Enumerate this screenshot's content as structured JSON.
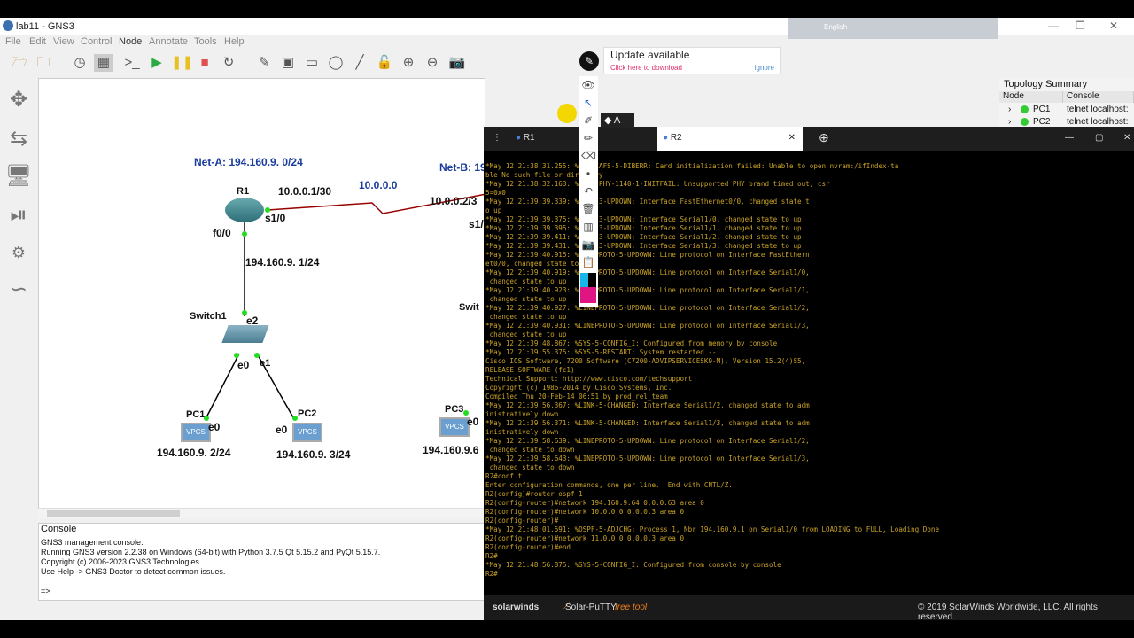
{
  "window": {
    "title": "lab11 - GNS3"
  },
  "menu": [
    "File",
    "Edit",
    "View",
    "Control",
    "Node",
    "Annotate",
    "Tools",
    "Help"
  ],
  "lang": "English",
  "update": {
    "title": "Update available",
    "link": "Click here to download",
    "ignore": "ignore"
  },
  "topology": {
    "title": "Topology Summary",
    "col_node": "Node",
    "col_console": "Console",
    "rows": [
      {
        "node": "PC1",
        "console": "telnet localhost:"
      },
      {
        "node": "PC2",
        "console": "telnet localhost:"
      }
    ]
  },
  "diagram": {
    "net_a": "Net-A: 194.160.9. 0/24",
    "net_b": "Net-B: 19",
    "link_net": "10.0.0.0",
    "r1": "R1",
    "r1_s1": "10.0.0.1/30",
    "r1_s1_if": "s1/0",
    "r1_f0": "f0/0",
    "r1_f0_ip": "194.160.9. 1/24",
    "r2_s1": "10.0.0.2/3",
    "r2_s1_if": "s1/",
    "switch1": "Switch1",
    "sw_e2": "e2",
    "sw_e0": "e0",
    "sw_e1": "e1",
    "switch2": "Swit",
    "pc1": "PC1",
    "pc1_e0": "e0",
    "pc1_ip": "194.160.9. 2/24",
    "pc2": "PC2",
    "pc2_e0": "e0",
    "pc2_ip": "194.160.9. 3/24",
    "pc3": "PC3",
    "pc3_e0": "e0",
    "pc3_ip": "194.160.9.6",
    "vpcs": "VPCS"
  },
  "console": {
    "title": "Console",
    "lines": [
      "GNS3 management console.",
      "Running GNS3 version 2.2.38 on Windows (64-bit) with Python 3.7.5 Qt 5.15.2 and PyQt 5.15.7.",
      "Copyright (c) 2006-2023 GNS3 Technologies.",
      "Use Help -> GNS3 Doctor to detect common issues.",
      "",
      "=>"
    ]
  },
  "putty": {
    "tabs": [
      "R1",
      "R2"
    ],
    "footer_brand": "solarwinds",
    "footer_app": "Solar-PuTTY",
    "footer_free": "free tool",
    "copyright": "© 2019 SolarWinds Worldwide, LLC. All rights reserved.",
    "terminal": "*May 12 21:38:31.255: %PCMCIAFS-5-DIBERR: Card initialization failed: Unable to open nvram:/ifIndex-ta\nble No such file or directory\n*May 12 21:38:32.163: %PA-3-PHY-1140-1-INITFAIL: Unsupported PHY brand timed out, csr\n5=0x0\n*May 12 21:39:39.339: %LINK-3-UPDOWN: Interface FastEthernet0/0, changed state t\no up\n*May 12 21:39:39.375: %LINK-3-UPDOWN: Interface Serial1/0, changed state to up\n*May 12 21:39:39.395: %LINK-3-UPDOWN: Interface Serial1/1, changed state to up\n*May 12 21:39:39.411: %LINK-3-UPDOWN: Interface Serial1/2, changed state to up\n*May 12 21:39:39.431: %LINK-3-UPDOWN: Interface Serial1/3, changed state to up\n*May 12 21:39:40.915: %LINEPROTO-5-UPDOWN: Line protocol on Interface FastEthern\net0/0, changed state to up\n*May 12 21:39:40.919: %LINEPROTO-5-UPDOWN: Line protocol on Interface Serial1/0,\n changed state to up\n*May 12 21:39:40.923: %LINEPROTO-5-UPDOWN: Line protocol on Interface Serial1/1,\n changed state to up\n*May 12 21:39:40.927: %LINEPROTO-5-UPDOWN: Line protocol on Interface Serial1/2,\n changed state to up\n*May 12 21:39:40.931: %LINEPROTO-5-UPDOWN: Line protocol on Interface Serial1/3,\n changed state to up\n*May 12 21:39:48.867: %SYS-5-CONFIG_I: Configured from memory by console\n*May 12 21:39:55.375: %SYS-5-RESTART: System restarted --\nCisco IOS Software, 7200 Software (C7200-ADVIPSERVICESK9-M), Version 15.2(4)S5,\nRELEASE SOFTWARE (fc1)\nTechnical Support: http://www.cisco.com/techsupport\nCopyright (c) 1986-2014 by Cisco Systems, Inc.\nCompiled Thu 20-Feb-14 06:51 by prod_rel_team\n*May 12 21:39:56.367: %LINK-5-CHANGED: Interface Serial1/2, changed state to adm\ninistratively down\n*May 12 21:39:56.371: %LINK-5-CHANGED: Interface Serial1/3, changed state to adm\ninistratively down\n*May 12 21:39:58.639: %LINEPROTO-5-UPDOWN: Line protocol on Interface Serial1/2,\n changed state to down\n*May 12 21:39:58.643: %LINEPROTO-5-UPDOWN: Line protocol on Interface Serial1/3,\n changed state to down\nR2#conf t\nEnter configuration commands, one per line.  End with CNTL/Z.\nR2(config)#router ospf 1\nR2(config-router)#network 194.160.9.64 0.0.0.63 area 0\nR2(config-router)#network 10.0.0.0 0.0.0.3 area 0\nR2(config-router)#\n*May 12 21:48:01.591: %OSPF-5-ADJCHG: Process 1, Nbr 194.160.9.1 on Serial1/0 from LOADING to FULL, Loading Done\nR2(config-router)#network 11.0.0.0 0.0.0.3 area 0\nR2(config-router)#end\nR2#\n*May 12 21:48:56.875: %SYS-5-CONFIG_I: Configured from console by console\nR2#"
  }
}
